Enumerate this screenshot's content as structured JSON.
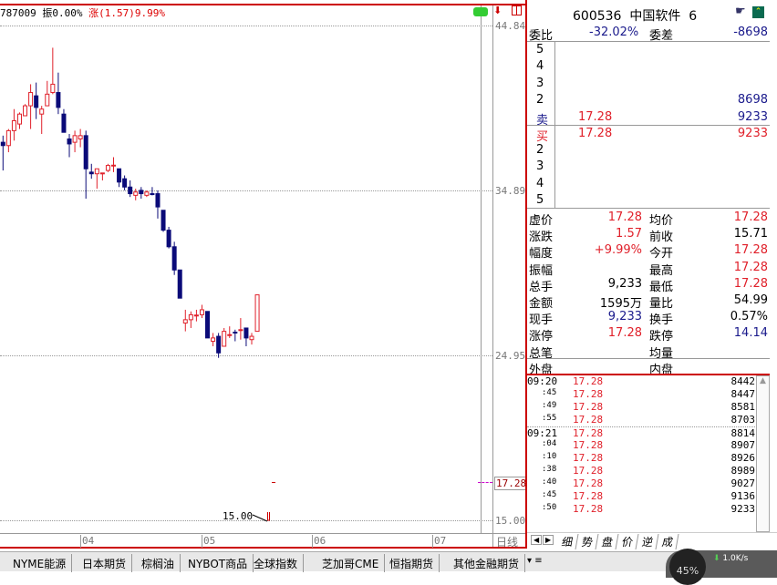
{
  "chart_header": {
    "code_tail": "787009",
    "amp_label": "振0.00%",
    "change_label": "涨(1.57)9.99%"
  },
  "price_scale": {
    "labels": [
      "44.84",
      "34.89",
      "24.95",
      "15.00"
    ],
    "current": "17.28"
  },
  "min_marker": "15.00",
  "axis": {
    "months": [
      "04",
      "05",
      "06",
      "07"
    ],
    "period": "日线"
  },
  "chart_data": {
    "type": "candlestick",
    "ylim": [
      15.0,
      44.84
    ],
    "up_color": "#e0202a",
    "down_color": "#0a0a78",
    "candles": [
      [
        37.8,
        38.2,
        36.1,
        37.6
      ],
      [
        37.6,
        38.6,
        37.2,
        38.5
      ],
      [
        38.5,
        39.8,
        37.9,
        39.1
      ],
      [
        38.9,
        39.6,
        38.6,
        39.5
      ],
      [
        39.4,
        40.1,
        39.4,
        40.0
      ],
      [
        40.0,
        41.3,
        38.6,
        40.8
      ],
      [
        40.6,
        41.4,
        39.2,
        39.9
      ],
      [
        39.5,
        40.0,
        38.3,
        39.8
      ],
      [
        40.0,
        41.5,
        40.0,
        40.7
      ],
      [
        40.8,
        43.5,
        40.7,
        41.3
      ],
      [
        40.8,
        42.0,
        39.5,
        39.9
      ],
      [
        39.5,
        39.8,
        38.4,
        38.4
      ],
      [
        38.0,
        38.3,
        36.9,
        37.7
      ],
      [
        37.8,
        38.5,
        37.2,
        38.2
      ],
      [
        38.0,
        38.6,
        37.5,
        38.2
      ],
      [
        38.2,
        38.5,
        34.4,
        36.2
      ],
      [
        36.0,
        36.5,
        35.6,
        35.9
      ],
      [
        35.9,
        36.2,
        35.0,
        36.2
      ],
      [
        35.9,
        35.96,
        35.5,
        35.95
      ],
      [
        36.1,
        36.5,
        36.0,
        36.4
      ],
      [
        36.4,
        36.9,
        36.0,
        36.42
      ],
      [
        36.2,
        36.2,
        35.1,
        35.4
      ],
      [
        35.6,
        35.8,
        34.9,
        35.1
      ],
      [
        35.1,
        35.5,
        34.5,
        34.7
      ],
      [
        34.6,
        35.0,
        34.3,
        34.8
      ],
      [
        34.9,
        35.1,
        34.4,
        34.7
      ],
      [
        34.6,
        34.9,
        34.5,
        34.8
      ],
      [
        34.7,
        35.1,
        34.6,
        34.68
      ],
      [
        34.7,
        34.9,
        33.2,
        33.9
      ],
      [
        33.7,
        33.7,
        32.4,
        32.5
      ],
      [
        32.5,
        32.7,
        31.4,
        31.5
      ],
      [
        31.5,
        31.8,
        29.8,
        30.1
      ],
      [
        30.1,
        30.1,
        28.4,
        28.4
      ],
      [
        26.9,
        27.7,
        26.4,
        27.1
      ],
      [
        27.1,
        27.6,
        26.6,
        27.4
      ],
      [
        27.35,
        27.7,
        27.0,
        27.38
      ],
      [
        27.4,
        28.0,
        27.2,
        27.7
      ],
      [
        27.6,
        27.6,
        26.0,
        26.0
      ],
      [
        25.8,
        26.3,
        25.5,
        26.0
      ],
      [
        26.1,
        26.3,
        24.8,
        25.1
      ],
      [
        25.5,
        26.6,
        25.5,
        26.4
      ],
      [
        26.2,
        26.7,
        26.0,
        26.2
      ],
      [
        26.35,
        26.5,
        25.8,
        26.3
      ],
      [
        26.5,
        27.2,
        25.9,
        26.5
      ],
      [
        26.6,
        26.6,
        25.5,
        26.0
      ],
      [
        25.9,
        26.3,
        25.6,
        26.1
      ],
      [
        26.4,
        28.6,
        26.4,
        28.6
      ]
    ]
  },
  "quote": {
    "code": "600536",
    "name": "中国软件",
    "suffix": "6",
    "wb_label": "委比",
    "wb": "-32.02%",
    "wc_label": "委差",
    "wc": "-8698",
    "sell": [
      {
        "l": "5",
        "p": "",
        "v": ""
      },
      {
        "l": "4",
        "p": "",
        "v": ""
      },
      {
        "l": "3",
        "p": "",
        "v": ""
      },
      {
        "l": "2",
        "p": "",
        "v": "8698"
      },
      {
        "l": "卖",
        "p": "17.28",
        "v": "9233"
      }
    ],
    "buy": [
      {
        "l": "买",
        "p": "17.28",
        "v": "9233"
      },
      {
        "l": "2",
        "p": "",
        "v": ""
      },
      {
        "l": "3",
        "p": "",
        "v": ""
      },
      {
        "l": "4",
        "p": "",
        "v": ""
      },
      {
        "l": "5",
        "p": "",
        "v": ""
      }
    ],
    "stats": [
      {
        "a": "虚价",
        "av": "17.28",
        "ac": "red",
        "b": "均价",
        "bv": "17.28",
        "bc": "red"
      },
      {
        "a": "涨跌",
        "av": "1.57",
        "ac": "red",
        "b": "前收",
        "bv": "15.71",
        "bc": ""
      },
      {
        "a": "幅度",
        "av": "+9.99%",
        "ac": "red",
        "b": "今开",
        "bv": "17.28",
        "bc": "red"
      },
      {
        "a": "振幅",
        "av": "",
        "ac": "",
        "b": "最高",
        "bv": "17.28",
        "bc": "red"
      },
      {
        "a": "总手",
        "av": "9,233",
        "ac": "",
        "b": "最低",
        "bv": "17.28",
        "bc": "red"
      },
      {
        "a": "金额",
        "av": "1595万",
        "ac": "",
        "b": "量比",
        "bv": "54.99",
        "bc": ""
      },
      {
        "a": "现手",
        "av": "9,233",
        "ac": "blue",
        "b": "换手",
        "bv": "0.57%",
        "bc": ""
      },
      {
        "a": "涨停",
        "av": "17.28",
        "ac": "red",
        "b": "跌停",
        "bv": "14.14",
        "bc": "blue"
      },
      {
        "a": "总笔",
        "av": "",
        "ac": "",
        "b": "均量",
        "bv": "",
        "bc": ""
      }
    ],
    "outer": "外盘",
    "inner": "内盘"
  },
  "trades": [
    [
      "09:20",
      "17.28",
      "8442"
    ],
    [
      ":45",
      "17.28",
      "8447"
    ],
    [
      ":49",
      "17.28",
      "8581"
    ],
    [
      ":55",
      "17.28",
      "8703"
    ],
    [
      "09:21",
      "17.28",
      "8814"
    ],
    [
      ":04",
      "17.28",
      "8907"
    ],
    [
      ":10",
      "17.28",
      "8926"
    ],
    [
      ":38",
      "17.28",
      "8989"
    ],
    [
      ":40",
      "17.28",
      "9027"
    ],
    [
      ":45",
      "17.28",
      "9136"
    ],
    [
      ":50",
      "17.28",
      "9233"
    ]
  ],
  "panel_tabs": [
    "细",
    "势",
    "盘",
    "价",
    "逆",
    "成"
  ],
  "market_tabs": [
    "NYME能源",
    "日本期货",
    "棕榈油",
    "NYBOT商品",
    "全球指数",
    "芝加哥CME",
    "恒指期货",
    "其他金融期货"
  ],
  "net": {
    "percent": "45%",
    "speed": "1.0K/s"
  }
}
